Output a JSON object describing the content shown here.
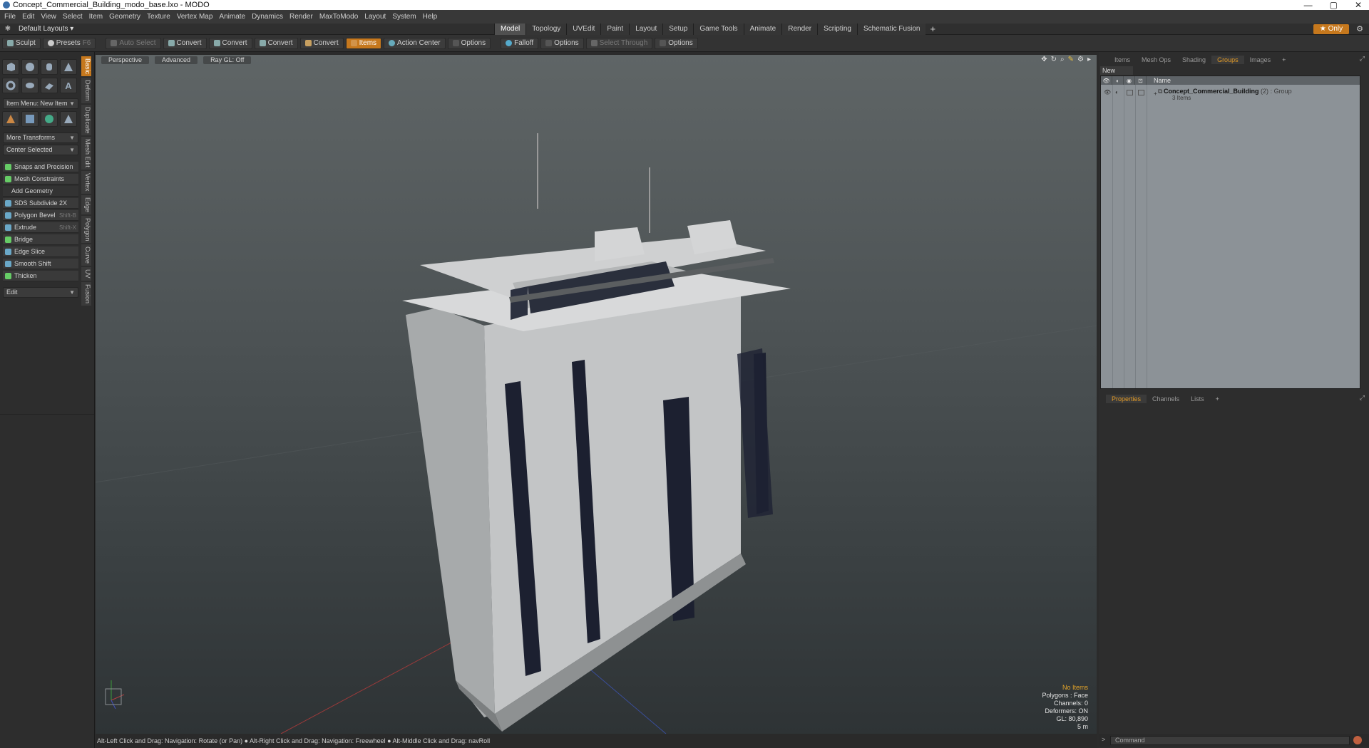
{
  "window": {
    "title": "Concept_Commercial_Building_modo_base.lxo - MODO",
    "controls": [
      "—",
      "▢",
      "✕"
    ]
  },
  "menu": [
    "File",
    "Edit",
    "View",
    "Select",
    "Item",
    "Geometry",
    "Texture",
    "Vertex Map",
    "Animate",
    "Dynamics",
    "Render",
    "MaxToModo",
    "Layout",
    "System",
    "Help"
  ],
  "layoutbar": {
    "default_layouts": "Default Layouts ▾",
    "tabs": [
      "Model",
      "Topology",
      "UVEdit",
      "Paint",
      "Layout",
      "Setup",
      "Game Tools",
      "Animate",
      "Render",
      "Scripting",
      "Schematic Fusion"
    ],
    "active_tab": "Model",
    "plus": "+",
    "only_label": "★ Only"
  },
  "toolbar": {
    "sculpt": "Sculpt",
    "presets": "Presets",
    "presets_key": "F6",
    "auto_select": "Auto Select",
    "convert1": "Convert",
    "convert2": "Convert",
    "convert3": "Convert",
    "convert4": "Convert",
    "items": "Items",
    "action_center": "Action Center",
    "options1": "Options",
    "falloff": "Falloff",
    "options2": "Options",
    "select_through": "Select Through",
    "options3": "Options"
  },
  "leftpanel": {
    "vtabs": [
      "Basic",
      "Deform",
      "Duplicate",
      "Mesh Edit",
      "Vertex",
      "Edge",
      "Polygon",
      "Curve",
      "UV",
      "Fusion"
    ],
    "item_menu": "Item Menu: New Item",
    "more_transforms": "More Transforms",
    "center_selected": "Center Selected",
    "snaps": "Snaps and Precision",
    "mesh_constraints": "Mesh Constraints",
    "add_geometry": "Add Geometry",
    "tools": [
      {
        "label": "SDS Subdivide 2X",
        "key": ""
      },
      {
        "label": "Polygon Bevel",
        "key": "Shift-B"
      },
      {
        "label": "Extrude",
        "key": "Shift-X"
      },
      {
        "label": "Bridge",
        "key": ""
      },
      {
        "label": "Edge Slice",
        "key": ""
      },
      {
        "label": "Smooth Shift",
        "key": ""
      },
      {
        "label": "Thicken",
        "key": ""
      }
    ],
    "edit": "Edit"
  },
  "viewport": {
    "perspective": "Perspective",
    "advanced": "Advanced",
    "raygl": "Ray GL: Off",
    "hud": {
      "no_items": "No Items",
      "polygons": "Polygons : Face",
      "channels": "Channels: 0",
      "deformers": "Deformers: ON",
      "gl": "GL: 80,890",
      "scale": "5 m"
    }
  },
  "statusbar": {
    "text": "Alt-Left Click and Drag: Navigation: Rotate (or Pan) ● Alt-Right Click and Drag: Navigation: Freewheel ● Alt-Middle Click and Drag: navRoll"
  },
  "rightpanel": {
    "tabs": [
      "Items",
      "Mesh Ops",
      "Shading",
      "Groups",
      "Images",
      "+"
    ],
    "active_tab": "Groups",
    "new_group": "New Group",
    "name_col": "Name",
    "group": {
      "name": "Concept_Commercial_Building",
      "count": "(2)",
      "type": ": Group",
      "items": "3 Items"
    },
    "props_tabs": [
      "Properties",
      "Channels",
      "Lists",
      "+"
    ],
    "props_active": "Properties",
    "command_placeholder": "Command"
  },
  "colors": {
    "accent": "#c6781d",
    "viewport_top": "#5f6566",
    "viewport_bottom": "#2e3335"
  }
}
